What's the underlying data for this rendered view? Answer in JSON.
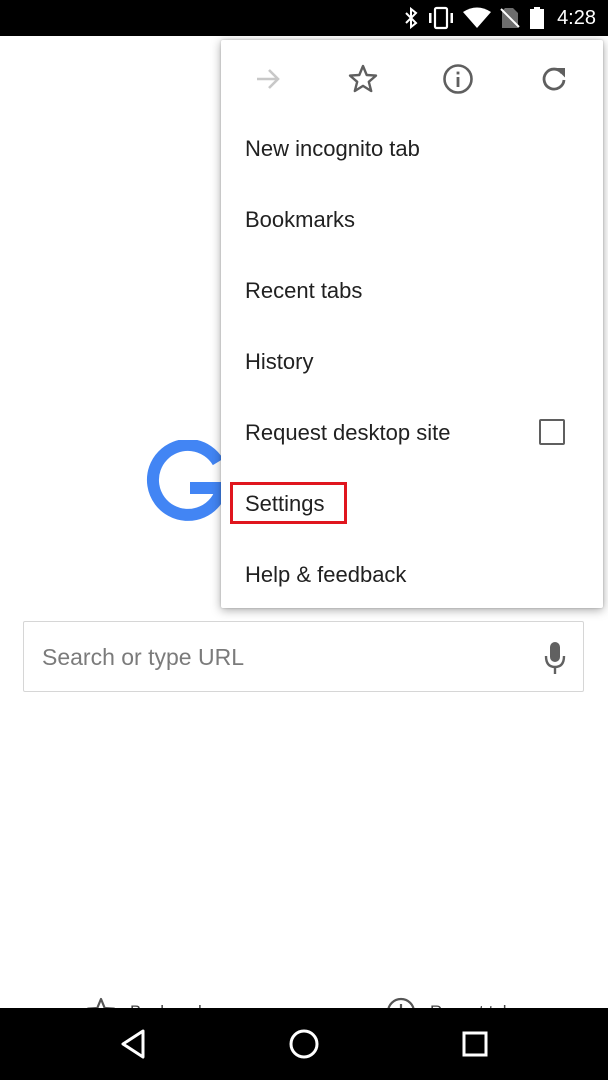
{
  "status_bar": {
    "time": "4:28",
    "icons": [
      "bluetooth-icon",
      "vibrate-icon",
      "wifi-icon",
      "no-sim-icon",
      "battery-icon"
    ]
  },
  "page": {
    "logo": "google-logo-partial",
    "search": {
      "placeholder": "Search or type URL",
      "icon": "mic-icon"
    },
    "bottom_links": [
      {
        "label": "Bookmarks",
        "icon": "star-icon"
      },
      {
        "label": "Recent tabs",
        "icon": "clock-icon"
      }
    ]
  },
  "menu": {
    "icon_row": [
      "forward-icon",
      "star-icon",
      "info-icon",
      "reload-icon"
    ],
    "items": [
      {
        "label": "New incognito tab"
      },
      {
        "label": "Bookmarks"
      },
      {
        "label": "Recent tabs"
      },
      {
        "label": "History"
      },
      {
        "label": "Request desktop site",
        "checkbox": false
      },
      {
        "label": "Settings",
        "highlighted": true
      },
      {
        "label": "Help & feedback"
      }
    ]
  },
  "nav_bar": {
    "buttons": [
      "back-icon",
      "home-icon",
      "recents-icon"
    ]
  },
  "colors": {
    "highlight": "#e0161e",
    "google_blue": "#4285f4",
    "text_primary": "#212121",
    "placeholder": "#7b7b7b"
  }
}
